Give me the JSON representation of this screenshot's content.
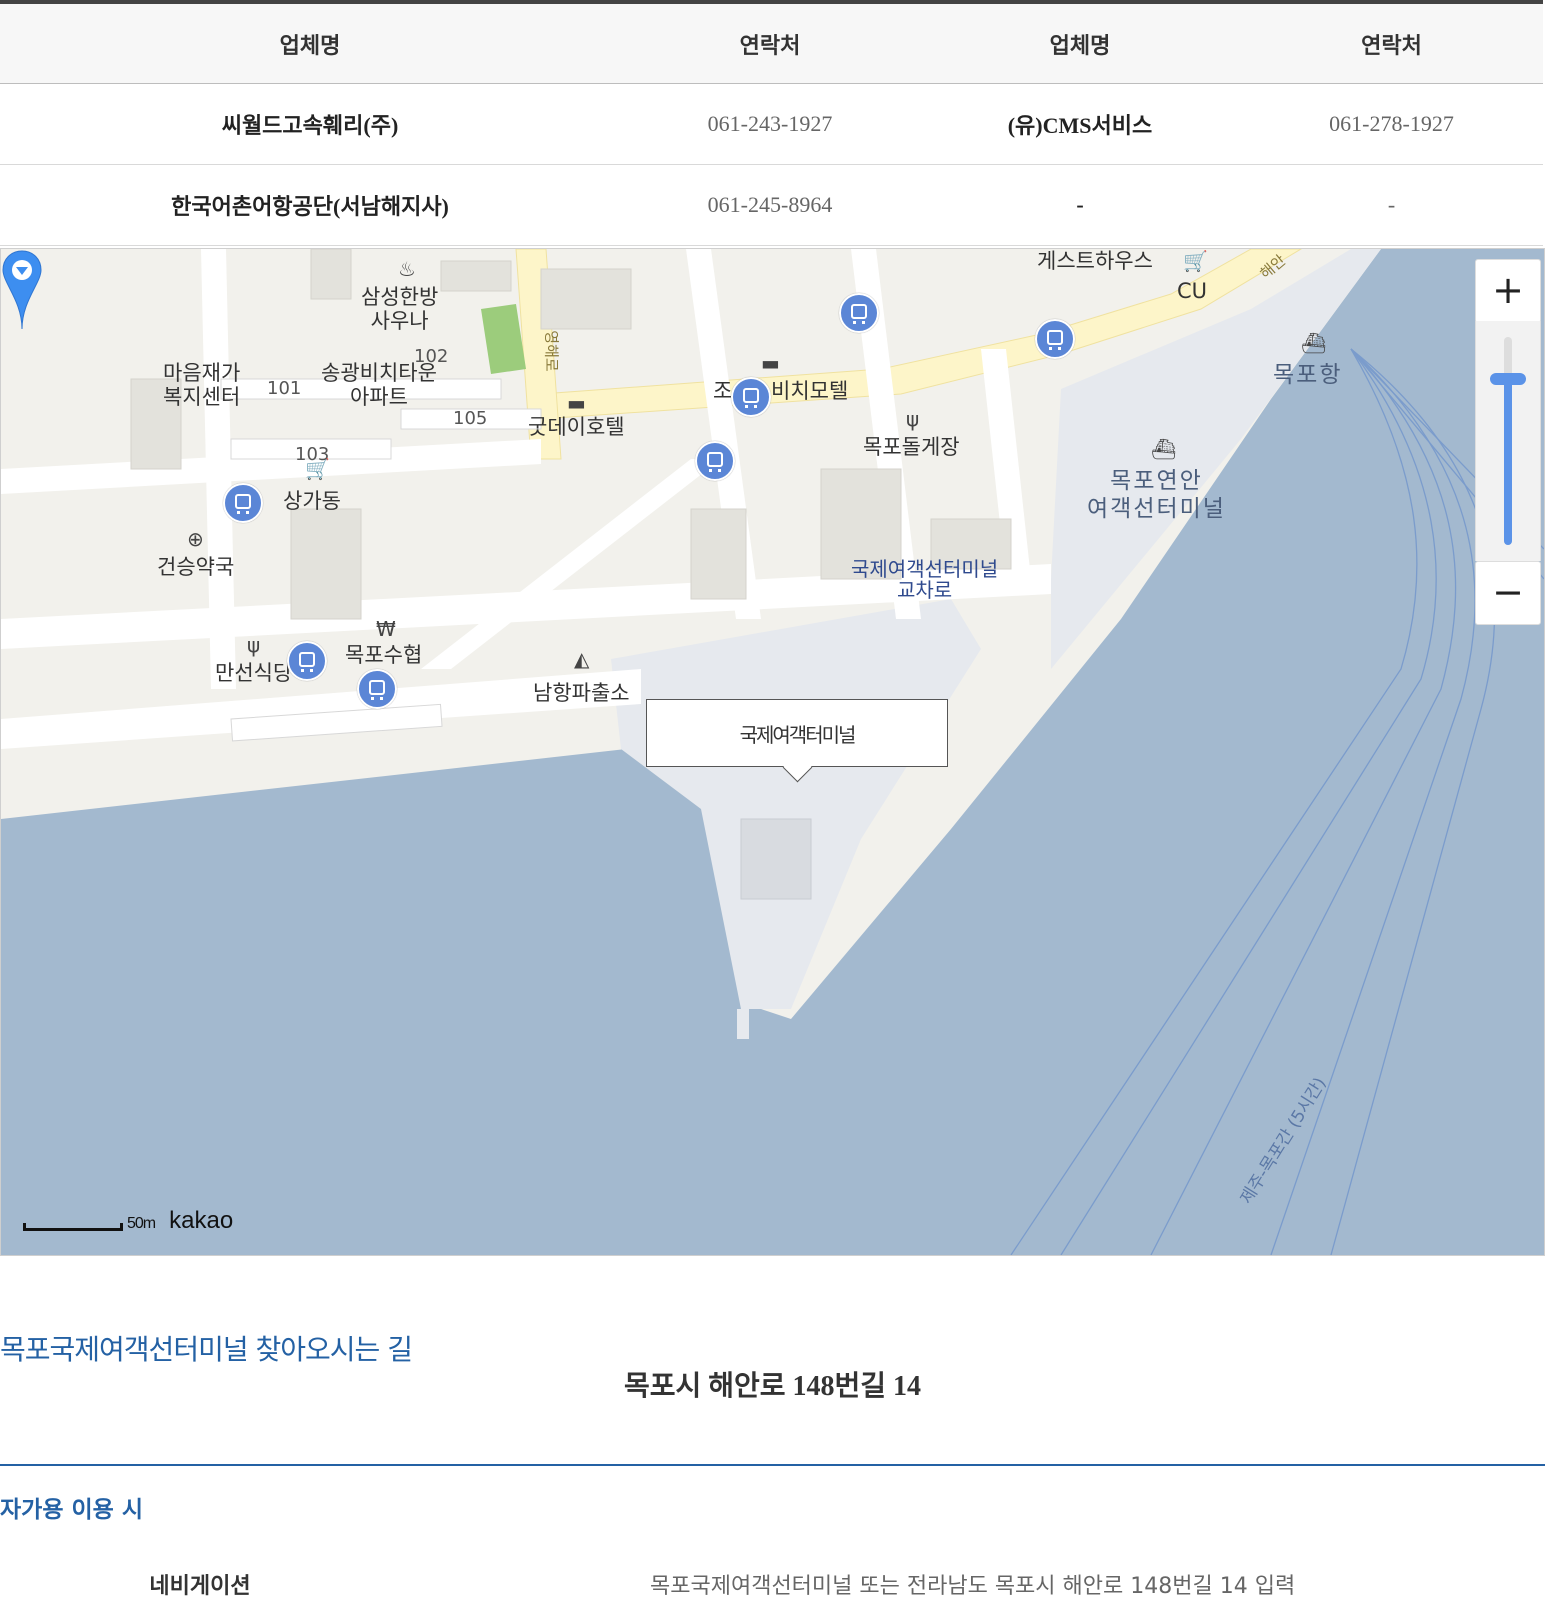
{
  "table": {
    "headers": [
      "업체명",
      "연락처",
      "업체명",
      "연락처"
    ],
    "rows": [
      [
        "씨월드고속훼리(주)",
        "061-243-1927",
        "(유)CMS서비스",
        "061-278-1927"
      ],
      [
        "한국어촌어항공단(서남해지사)",
        "061-245-8964",
        "-",
        "-"
      ]
    ]
  },
  "map": {
    "pois": {
      "sauna": "삼성한방\n사우나",
      "welfare": "마음재가\n복지센터",
      "apt": "송광비치타운\n아파트",
      "b101": "101",
      "b102": "102",
      "b103": "103",
      "b105": "105",
      "good_hotel": "굿데이호텔",
      "motel": "조",
      "motel2": "비치모텔",
      "stone": "목포돌게장",
      "shopping": "상가동",
      "pharmacy": "건승약국",
      "restaurant": "만선식당",
      "suhyup": "목포수협",
      "police": "남항파출소",
      "guesthouse": "게스트하우스",
      "cu": "CU",
      "port": "목포항",
      "coastal_terminal": "목포연안\n여객선터미널",
      "intersection": "국제여객선터미널\n교차로",
      "road_vertical": "영해로",
      "road_coast": "해안",
      "ferry_route": "제주-목포간 (5시간)"
    },
    "marker_label": "국제여객터미널",
    "zoom": {
      "plus": "+",
      "minus": "−",
      "level": 0.2
    },
    "scale_label": "50m",
    "brand": "kakao",
    "icons": [
      "sauna-icon",
      "bed-icon",
      "restaurant-icon",
      "cart-icon",
      "pharmacy-icon",
      "won-icon",
      "police-icon",
      "ship-icon",
      "bus-icon",
      "map-pin-icon"
    ]
  },
  "directions": {
    "title": "목포국제여객선터미널 찾아오시는 길",
    "address": "목포시 해안로 148번길 14",
    "car_title": "자가용 이용 시",
    "nav_label": "네비게이션",
    "nav_value": "목포국제여객선터미널 또는 전라남도 목포시 해안로 148번길 14 입력"
  },
  "colors": {
    "accent": "#2461a4",
    "water": "#a3b9cf",
    "land": "#f2f1ec",
    "road_main": "#fdf5c9",
    "pin": "#3d8ef0"
  }
}
